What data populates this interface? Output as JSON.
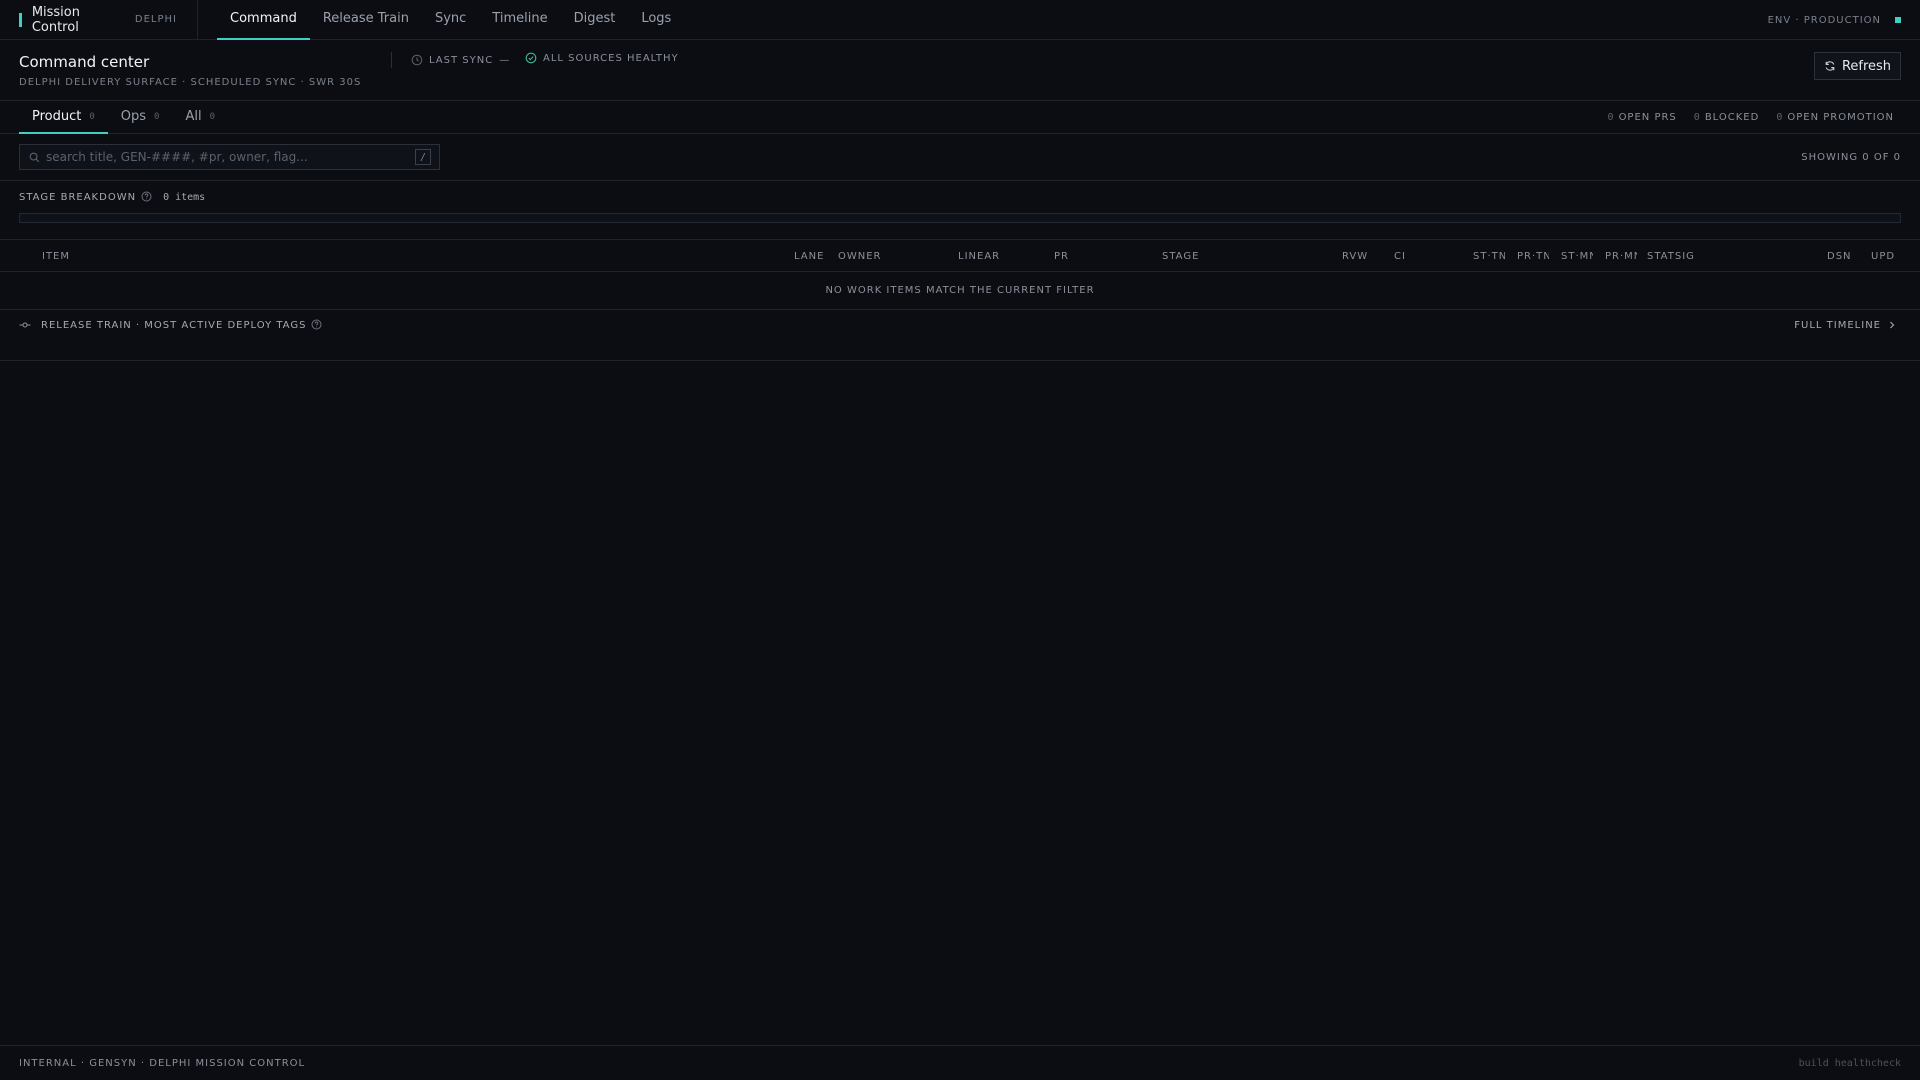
{
  "brand": {
    "name": "Mission Control",
    "sub": "DELPHI"
  },
  "nav": [
    {
      "label": "Command",
      "active": true
    },
    {
      "label": "Release Train"
    },
    {
      "label": "Sync"
    },
    {
      "label": "Timeline"
    },
    {
      "label": "Digest"
    },
    {
      "label": "Logs"
    }
  ],
  "env": {
    "label": "ENV · PRODUCTION",
    "color": "#3fd0c0"
  },
  "header": {
    "title": "Command center",
    "subtitle": "DELPHI DELIVERY SURFACE · SCHEDULED SYNC · SWR 30S",
    "last_sync_label": "LAST SYNC",
    "last_sync_value": "—",
    "health": "ALL SOURCES HEALTHY",
    "refresh_label": "Refresh"
  },
  "tabs": [
    {
      "label": "Product",
      "count": "0",
      "active": true
    },
    {
      "label": "Ops",
      "count": "0"
    },
    {
      "label": "All",
      "count": "0"
    }
  ],
  "stats": [
    {
      "count": "0",
      "label": "OPEN PRS"
    },
    {
      "count": "0",
      "label": "BLOCKED"
    },
    {
      "count": "0",
      "label": "OPEN PROMOTION"
    }
  ],
  "search": {
    "placeholder": "search title, GEN-####, #pr, owner, flag...",
    "shortcut": "/"
  },
  "showing": "SHOWING 0 OF 0",
  "stage": {
    "label": "STAGE BREAKDOWN",
    "count": "0 items"
  },
  "table": {
    "columns": [
      "ITEM",
      "LANE",
      "OWNER",
      "LINEAR",
      "PR",
      "STAGE",
      "RVW",
      "CI",
      "ST·TN",
      "PR·TN",
      "ST·MN",
      "PR·MN",
      "STATSIG",
      "DSN",
      "UPD"
    ],
    "empty": "NO WORK ITEMS MATCH THE CURRENT FILTER"
  },
  "train": {
    "label": "RELEASE TRAIN · MOST ACTIVE DEPLOY TAGS",
    "link": "FULL TIMELINE"
  },
  "footer": {
    "left": "INTERNAL · GENSYN · DELPHI MISSION CONTROL",
    "right": "build healthcheck"
  },
  "colors": {
    "accent": "#3fd0c0",
    "healthy": "#3fb89a"
  }
}
